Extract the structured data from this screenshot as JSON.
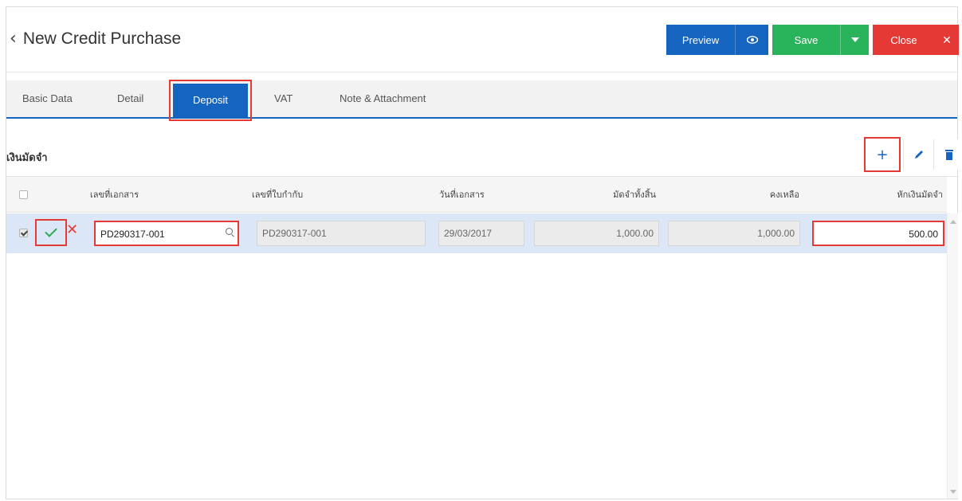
{
  "header": {
    "title": "New Credit Purchase",
    "preview_label": "Preview",
    "save_label": "Save",
    "close_label": "Close"
  },
  "tabs": [
    {
      "label": "Basic Data"
    },
    {
      "label": "Detail"
    },
    {
      "label": "Deposit",
      "active": true
    },
    {
      "label": "VAT"
    },
    {
      "label": "Note & Attachment"
    }
  ],
  "section": {
    "title": "เงินมัดจำ"
  },
  "table": {
    "columns": [
      "เลขที่เอกสาร",
      "เลขที่ใบกำกับ",
      "วันที่เอกสาร",
      "มัดจำทั้งสิ้น",
      "คงเหลือ",
      "หักเงินมัดจำ"
    ],
    "rows": [
      {
        "checked": true,
        "doc_no": "PD290317-001",
        "invoice_no": "PD290317-001",
        "doc_date": "29/03/2017",
        "deposit_total": "1,000.00",
        "remaining": "1,000.00",
        "deduct": "500.00"
      }
    ]
  },
  "colors": {
    "primary": "#1565c0",
    "save": "#29b35a",
    "close": "#e53935",
    "highlight": "#e53935",
    "row_selected": "#dbe7f7"
  },
  "icons": {
    "back": "chevron-left-icon",
    "preview": "eye-icon",
    "save_menu": "caret-down-icon",
    "close": "close-icon",
    "add": "plus-icon",
    "edit": "pencil-icon",
    "delete": "trash-icon",
    "search": "search-icon"
  }
}
